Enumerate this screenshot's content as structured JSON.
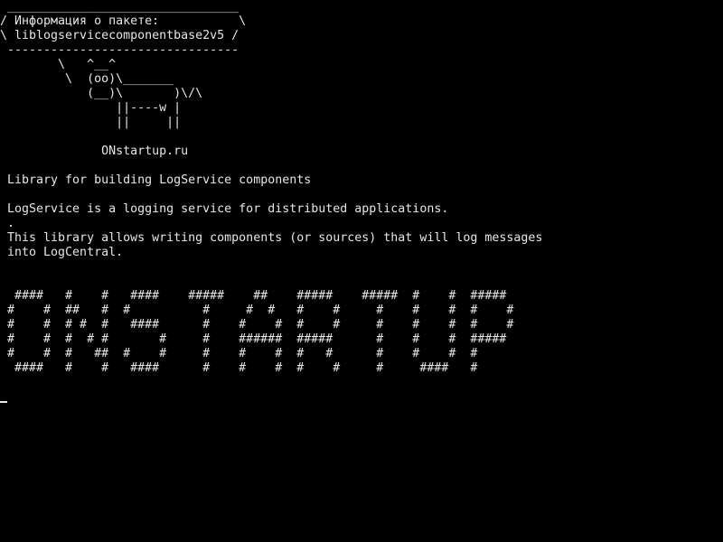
{
  "terminal": {
    "background": "#000000",
    "foreground": "#e6e6e6",
    "lines": [
      " ________________________________",
      "/ Информация о пакете:           \\",
      "\\ liblogservicecomponentbase2v5 /",
      " --------------------------------",
      "        \\   ^__^",
      "         \\  (oo)\\_______",
      "            (__)\\       )\\/\\",
      "                ||----w |",
      "                ||     ||",
      "",
      "              ONstartup.ru",
      "",
      " Library for building LogService components",
      "",
      " LogService is a logging service for distributed applications.",
      " .",
      " This library allows writing components (or sources) that will log messages",
      " into LogCentral.",
      "",
      "",
      "  ####   #    #   ####    #####    ##    #####    #####  #    #  #####",
      " #    #  ##   #  #          #     #  #   #    #     #    #    #  #    #",
      " #    #  # #  #   ####      #    #    #  #    #     #    #    #  #    #",
      " #    #  #  # #       #     #    ######  #####      #    #    #  #####",
      " #    #  #   ##  #    #     #    #    #  #   #      #    #    #  #",
      "  ####   #    #   ####      #    #    #  #    #     #     ####   #"
    ]
  }
}
